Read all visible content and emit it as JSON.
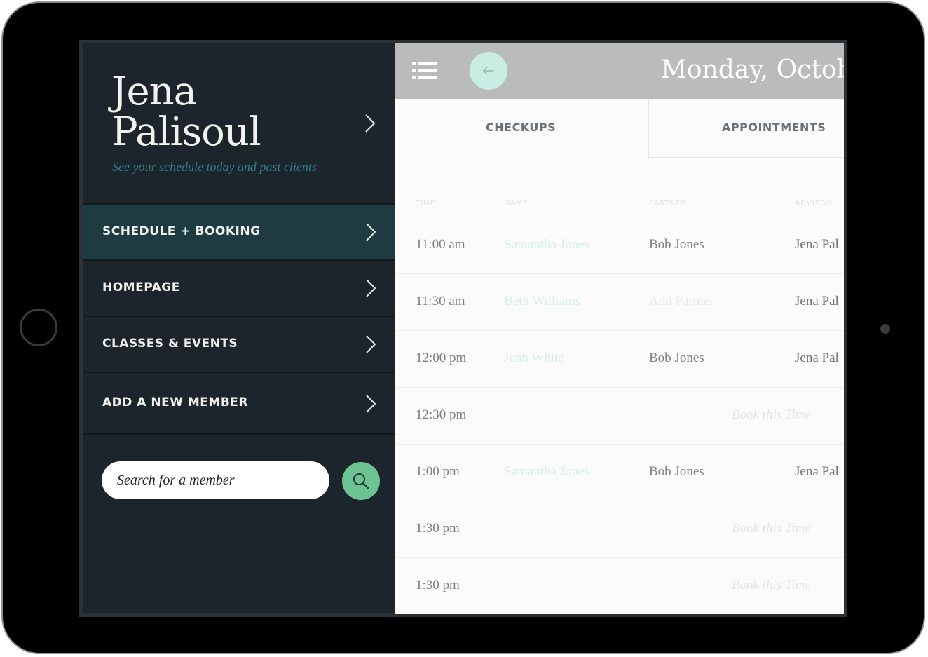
{
  "profile": {
    "first_name": "Jena",
    "last_name": "Palisoul",
    "subtitle": "See your schedule today and past clients"
  },
  "menu": [
    {
      "label": "SCHEDULE + BOOKING",
      "active": true
    },
    {
      "label": "HOMEPAGE",
      "active": false
    },
    {
      "label": "CLASSES & EVENTS",
      "active": false
    },
    {
      "label": "ADD A NEW MEMBER",
      "active": false
    }
  ],
  "search": {
    "placeholder": "Search for a member"
  },
  "header": {
    "date": "Monday, Octob"
  },
  "tabs": [
    {
      "label": "CHECKUPS"
    },
    {
      "label": "APPOINTMENTS"
    }
  ],
  "table": {
    "columns": [
      "TIME",
      "NAME",
      "PARTNER",
      "ADVISOR"
    ],
    "rows": [
      {
        "time": "11:00 am",
        "name": "Samantha Jones",
        "partner": "Bob Jones",
        "advisor": "Jena Pal"
      },
      {
        "time": "11:30 am",
        "name": "Beth Williams",
        "partner": "Add Partner",
        "advisor": "Jena Pal"
      },
      {
        "time": "12:00 pm",
        "name": "Jenn White",
        "partner": "Bob Jones",
        "advisor": "Jena Pal"
      },
      {
        "time": "12:30 pm",
        "book": "Book this Time"
      },
      {
        "time": "1:00 pm",
        "name": "Samantha Jones",
        "partner": "Bob Jones",
        "advisor": "Jena Pal"
      },
      {
        "time": "1:30 pm",
        "book": "Book this Time"
      },
      {
        "time": "1:30 pm",
        "book": "Book this Time"
      }
    ]
  },
  "colors": {
    "sidebar_bg": "#1c242c",
    "active_item_bg": "#1e3b41",
    "accent_green": "#6ec393",
    "subtitle_teal": "#2e7f8c",
    "topbar_gray": "#b9bcba"
  },
  "icons": [
    "chevron-right-icon",
    "search-icon",
    "hamburger-menu-icon",
    "back-arrow-icon"
  ]
}
